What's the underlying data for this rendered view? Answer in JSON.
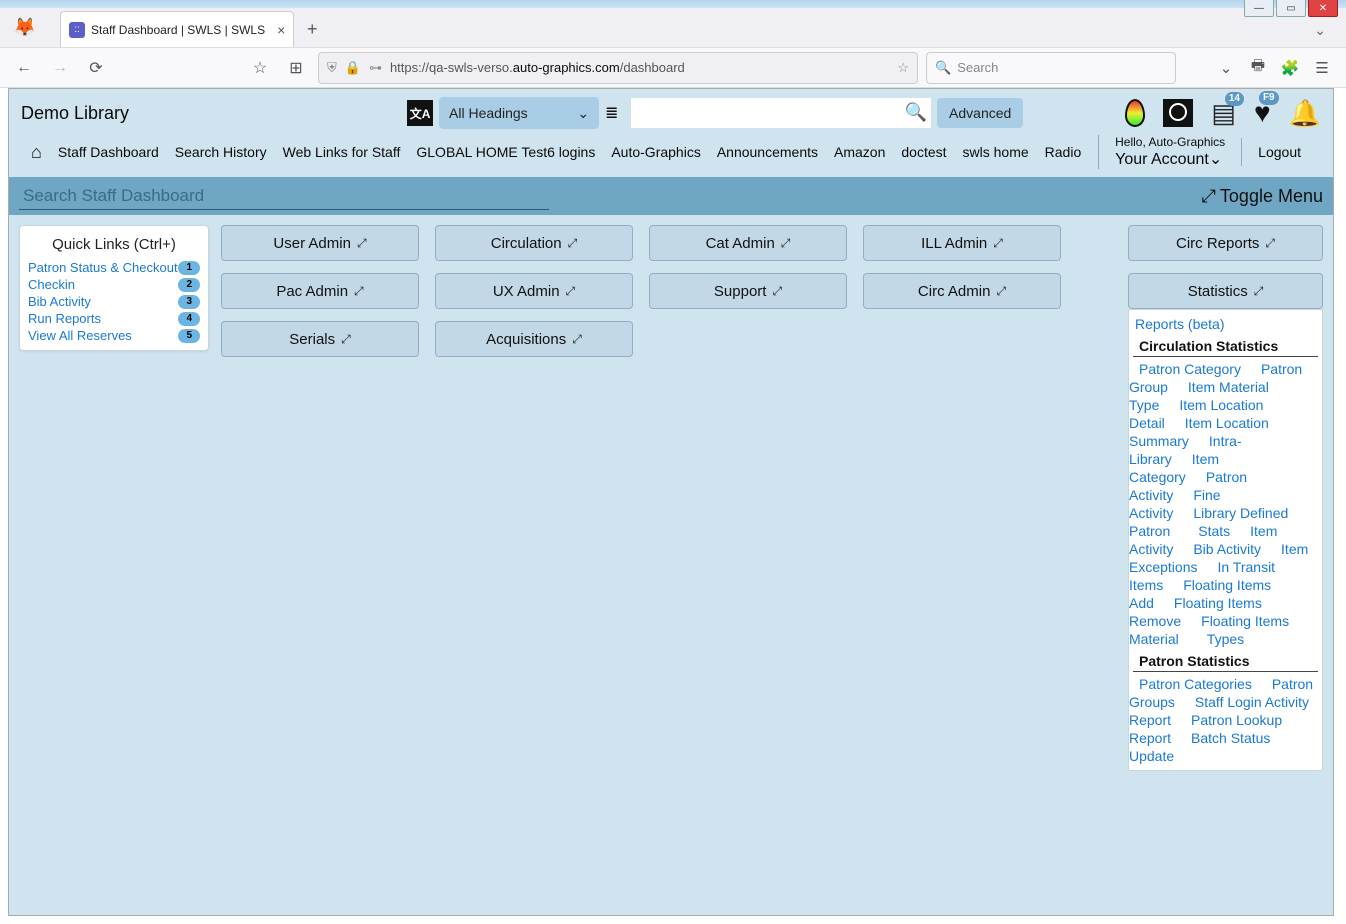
{
  "browser": {
    "tab_title": "Staff Dashboard | SWLS | SWLS",
    "url_prefix": "https://qa-swls-verso.",
    "url_domain": "auto-graphics.com",
    "url_path": "/dashboard",
    "search_placeholder": "Search"
  },
  "app": {
    "library_name": "Demo Library",
    "headings_select": "All Headings",
    "advanced_label": "Advanced",
    "list_badge": "14",
    "heart_badge": "F9",
    "greeting": "Hello, Auto-Graphics",
    "account_label": "Your Account",
    "logout_label": "Logout",
    "nav": [
      "Staff Dashboard",
      "Search History",
      "Web Links for Staff",
      "GLOBAL HOME Test6 logins",
      "Auto-Graphics",
      "Announcements",
      "Amazon",
      "doctest",
      "swls home",
      "Radio"
    ]
  },
  "dashboard": {
    "search_placeholder": "Search Staff Dashboard",
    "toggle_label": "Toggle Menu",
    "quicklinks_title": "Quick Links (Ctrl+)",
    "quicklinks": [
      {
        "label": "Patron Status & Checkout",
        "key": "1"
      },
      {
        "label": "Checkin",
        "key": "2"
      },
      {
        "label": "Bib Activity",
        "key": "3"
      },
      {
        "label": "Run Reports",
        "key": "4"
      },
      {
        "label": "View All Reserves",
        "key": "5"
      }
    ],
    "tiles_row1": [
      "User Admin",
      "Circulation",
      "Cat Admin",
      "ILL Admin"
    ],
    "tiles_row2": [
      "Pac Admin",
      "UX Admin",
      "Support",
      "Circ Admin"
    ],
    "tiles_row3": [
      "Serials",
      "Acquisitions"
    ],
    "right_tiles": [
      "Circ Reports",
      "Statistics"
    ],
    "reports_beta": "Reports (beta)",
    "circ_stats_header": "Circulation Statistics",
    "circ_stats": [
      "Patron Category",
      "Patron Group",
      "Item Material Type",
      "Item Location Detail",
      "Item Location Summary",
      "Intra-Library",
      "Item Category",
      "Patron Activity",
      "Fine Activity",
      "Library Defined Patron Stats",
      "Item Activity",
      "Bib Activity",
      "Item Exceptions",
      "In Transit Items",
      "Floating Items Add",
      "Floating Items Remove",
      "Floating Items Material Types"
    ],
    "patron_stats_header": "Patron Statistics",
    "patron_stats": [
      "Patron Categories",
      "Patron Groups",
      "Staff Login Activity Report",
      "Patron Lookup Report",
      "Batch Status Update"
    ]
  }
}
